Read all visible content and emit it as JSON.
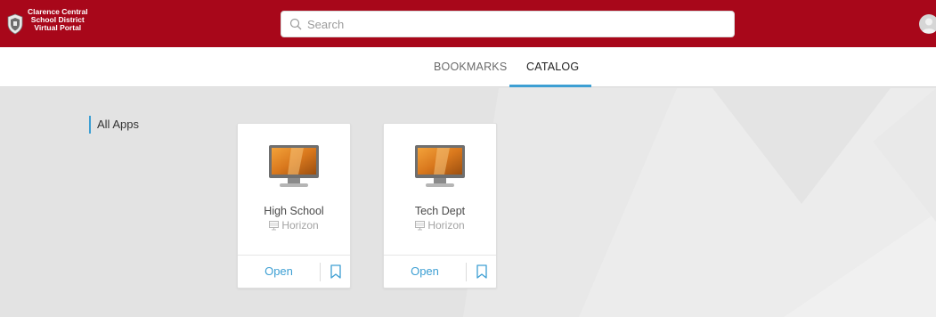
{
  "header": {
    "brand_lines": [
      "Clarence Central",
      "School District",
      "Virtual Portal"
    ],
    "search_placeholder": "Search",
    "brand_color": "#a8071a"
  },
  "tabs": [
    {
      "label": "BOOKMARKS",
      "active": false
    },
    {
      "label": "CATALOG",
      "active": true
    }
  ],
  "accent_color": "#3d9fd3",
  "sidebar": {
    "items": [
      {
        "label": "All Apps",
        "active": true
      }
    ]
  },
  "apps": [
    {
      "name": "High School",
      "type": "Horizon",
      "open_label": "Open",
      "icon": "desktop-monitor-icon"
    },
    {
      "name": "Tech Dept",
      "type": "Horizon",
      "open_label": "Open",
      "icon": "desktop-monitor-icon"
    }
  ]
}
